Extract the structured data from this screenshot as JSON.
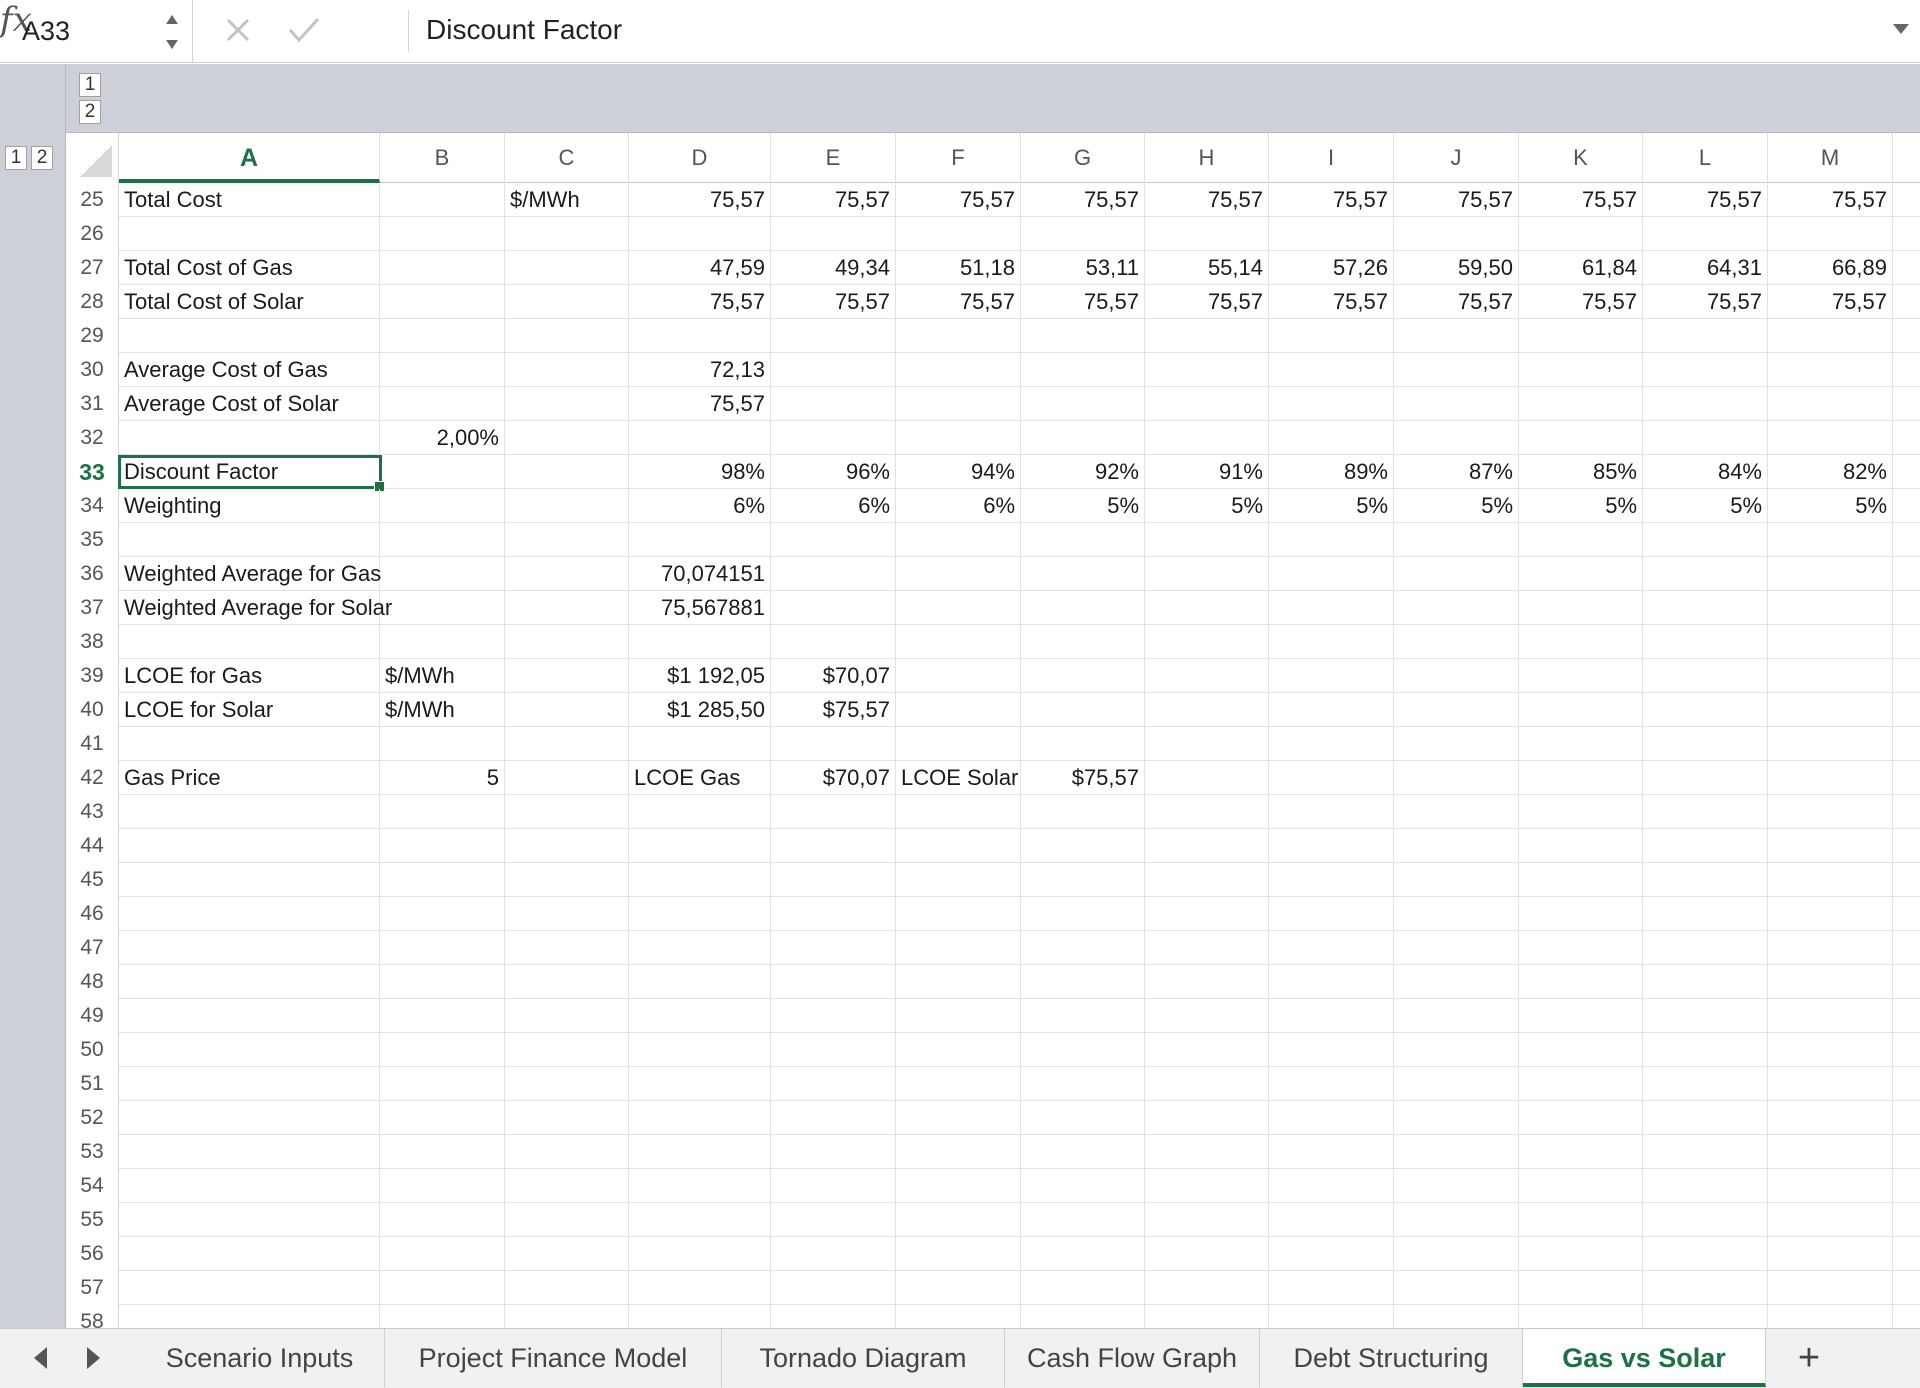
{
  "formula_bar": {
    "cell_ref": "A33",
    "formula": "Discount Factor"
  },
  "outline": {
    "column_levels": [
      "1",
      "2"
    ],
    "row_levels": [
      "1",
      "2"
    ]
  },
  "columns": [
    "A",
    "B",
    "C",
    "D",
    "E",
    "F",
    "G",
    "H",
    "I",
    "J",
    "K",
    "L",
    "M"
  ],
  "active_column": "A",
  "active_row": "33",
  "rows": [
    {
      "num": "25",
      "cells": {
        "A": "Total Cost",
        "C": "$/MWh",
        "D": "75,57",
        "E": "75,57",
        "F": "75,57",
        "G": "75,57",
        "H": "75,57",
        "I": "75,57",
        "J": "75,57",
        "K": "75,57",
        "L": "75,57",
        "M": "75,57"
      }
    },
    {
      "num": "26",
      "cells": {}
    },
    {
      "num": "27",
      "cells": {
        "A": "Total Cost of Gas",
        "D": "47,59",
        "E": "49,34",
        "F": "51,18",
        "G": "53,11",
        "H": "55,14",
        "I": "57,26",
        "J": "59,50",
        "K": "61,84",
        "L": "64,31",
        "M": "66,89"
      }
    },
    {
      "num": "28",
      "cells": {
        "A": "Total Cost of Solar",
        "D": "75,57",
        "E": "75,57",
        "F": "75,57",
        "G": "75,57",
        "H": "75,57",
        "I": "75,57",
        "J": "75,57",
        "K": "75,57",
        "L": "75,57",
        "M": "75,57"
      }
    },
    {
      "num": "29",
      "cells": {}
    },
    {
      "num": "30",
      "cells": {
        "A": "Average Cost of Gas",
        "D": "72,13"
      }
    },
    {
      "num": "31",
      "cells": {
        "A": "Average Cost of Solar",
        "D": "75,57"
      }
    },
    {
      "num": "32",
      "cells": {
        "B": "2,00%"
      }
    },
    {
      "num": "33",
      "cells": {
        "A": "Discount Factor",
        "D": "98%",
        "E": "96%",
        "F": "94%",
        "G": "92%",
        "H": "91%",
        "I": "89%",
        "J": "87%",
        "K": "85%",
        "L": "84%",
        "M": "82%"
      }
    },
    {
      "num": "34",
      "cells": {
        "A": "Weighting",
        "D": "6%",
        "E": "6%",
        "F": "6%",
        "G": "5%",
        "H": "5%",
        "I": "5%",
        "J": "5%",
        "K": "5%",
        "L": "5%",
        "M": "5%"
      }
    },
    {
      "num": "35",
      "cells": {}
    },
    {
      "num": "36",
      "cells": {
        "A": "Weighted Average for Gas",
        "D": "70,074151"
      }
    },
    {
      "num": "37",
      "cells": {
        "A": "Weighted Average for Solar",
        "D": "75,567881"
      }
    },
    {
      "num": "38",
      "cells": {}
    },
    {
      "num": "39",
      "cells": {
        "A": "LCOE for Gas",
        "B": "$/MWh",
        "D": "$1 192,05",
        "E": "$70,07"
      }
    },
    {
      "num": "40",
      "cells": {
        "A": "LCOE for Solar",
        "B": "$/MWh",
        "D": "$1 285,50",
        "E": "$75,57"
      }
    },
    {
      "num": "41",
      "cells": {}
    },
    {
      "num": "42",
      "cells": {
        "A": "Gas Price",
        "B": "5",
        "D": "LCOE Gas",
        "E": "$70,07",
        "F": "LCOE Solar",
        "G": "$75,57"
      }
    },
    {
      "num": "43",
      "cells": {}
    },
    {
      "num": "44",
      "cells": {}
    },
    {
      "num": "45",
      "cells": {}
    },
    {
      "num": "46",
      "cells": {}
    },
    {
      "num": "47",
      "cells": {}
    },
    {
      "num": "48",
      "cells": {}
    },
    {
      "num": "49",
      "cells": {}
    },
    {
      "num": "50",
      "cells": {}
    },
    {
      "num": "51",
      "cells": {}
    },
    {
      "num": "52",
      "cells": {}
    },
    {
      "num": "53",
      "cells": {}
    },
    {
      "num": "54",
      "cells": {}
    },
    {
      "num": "55",
      "cells": {}
    },
    {
      "num": "56",
      "cells": {}
    },
    {
      "num": "57",
      "cells": {}
    },
    {
      "num": "58",
      "cells": {}
    }
  ],
  "sheet_tabs": [
    {
      "label": "Scenario Inputs",
      "active": false
    },
    {
      "label": "Project Finance Model",
      "active": false
    },
    {
      "label": "Tornado Diagram",
      "active": false
    },
    {
      "label": "Cash Flow Graph",
      "active": false
    },
    {
      "label": "Debt Structuring",
      "active": false
    },
    {
      "label": "Gas vs Solar",
      "active": true
    }
  ],
  "add_sheet_label": "+",
  "colors": {
    "accent": "#1e7145",
    "outline_band": "#cdd0d6",
    "grid_line": "#e3e3e3"
  }
}
